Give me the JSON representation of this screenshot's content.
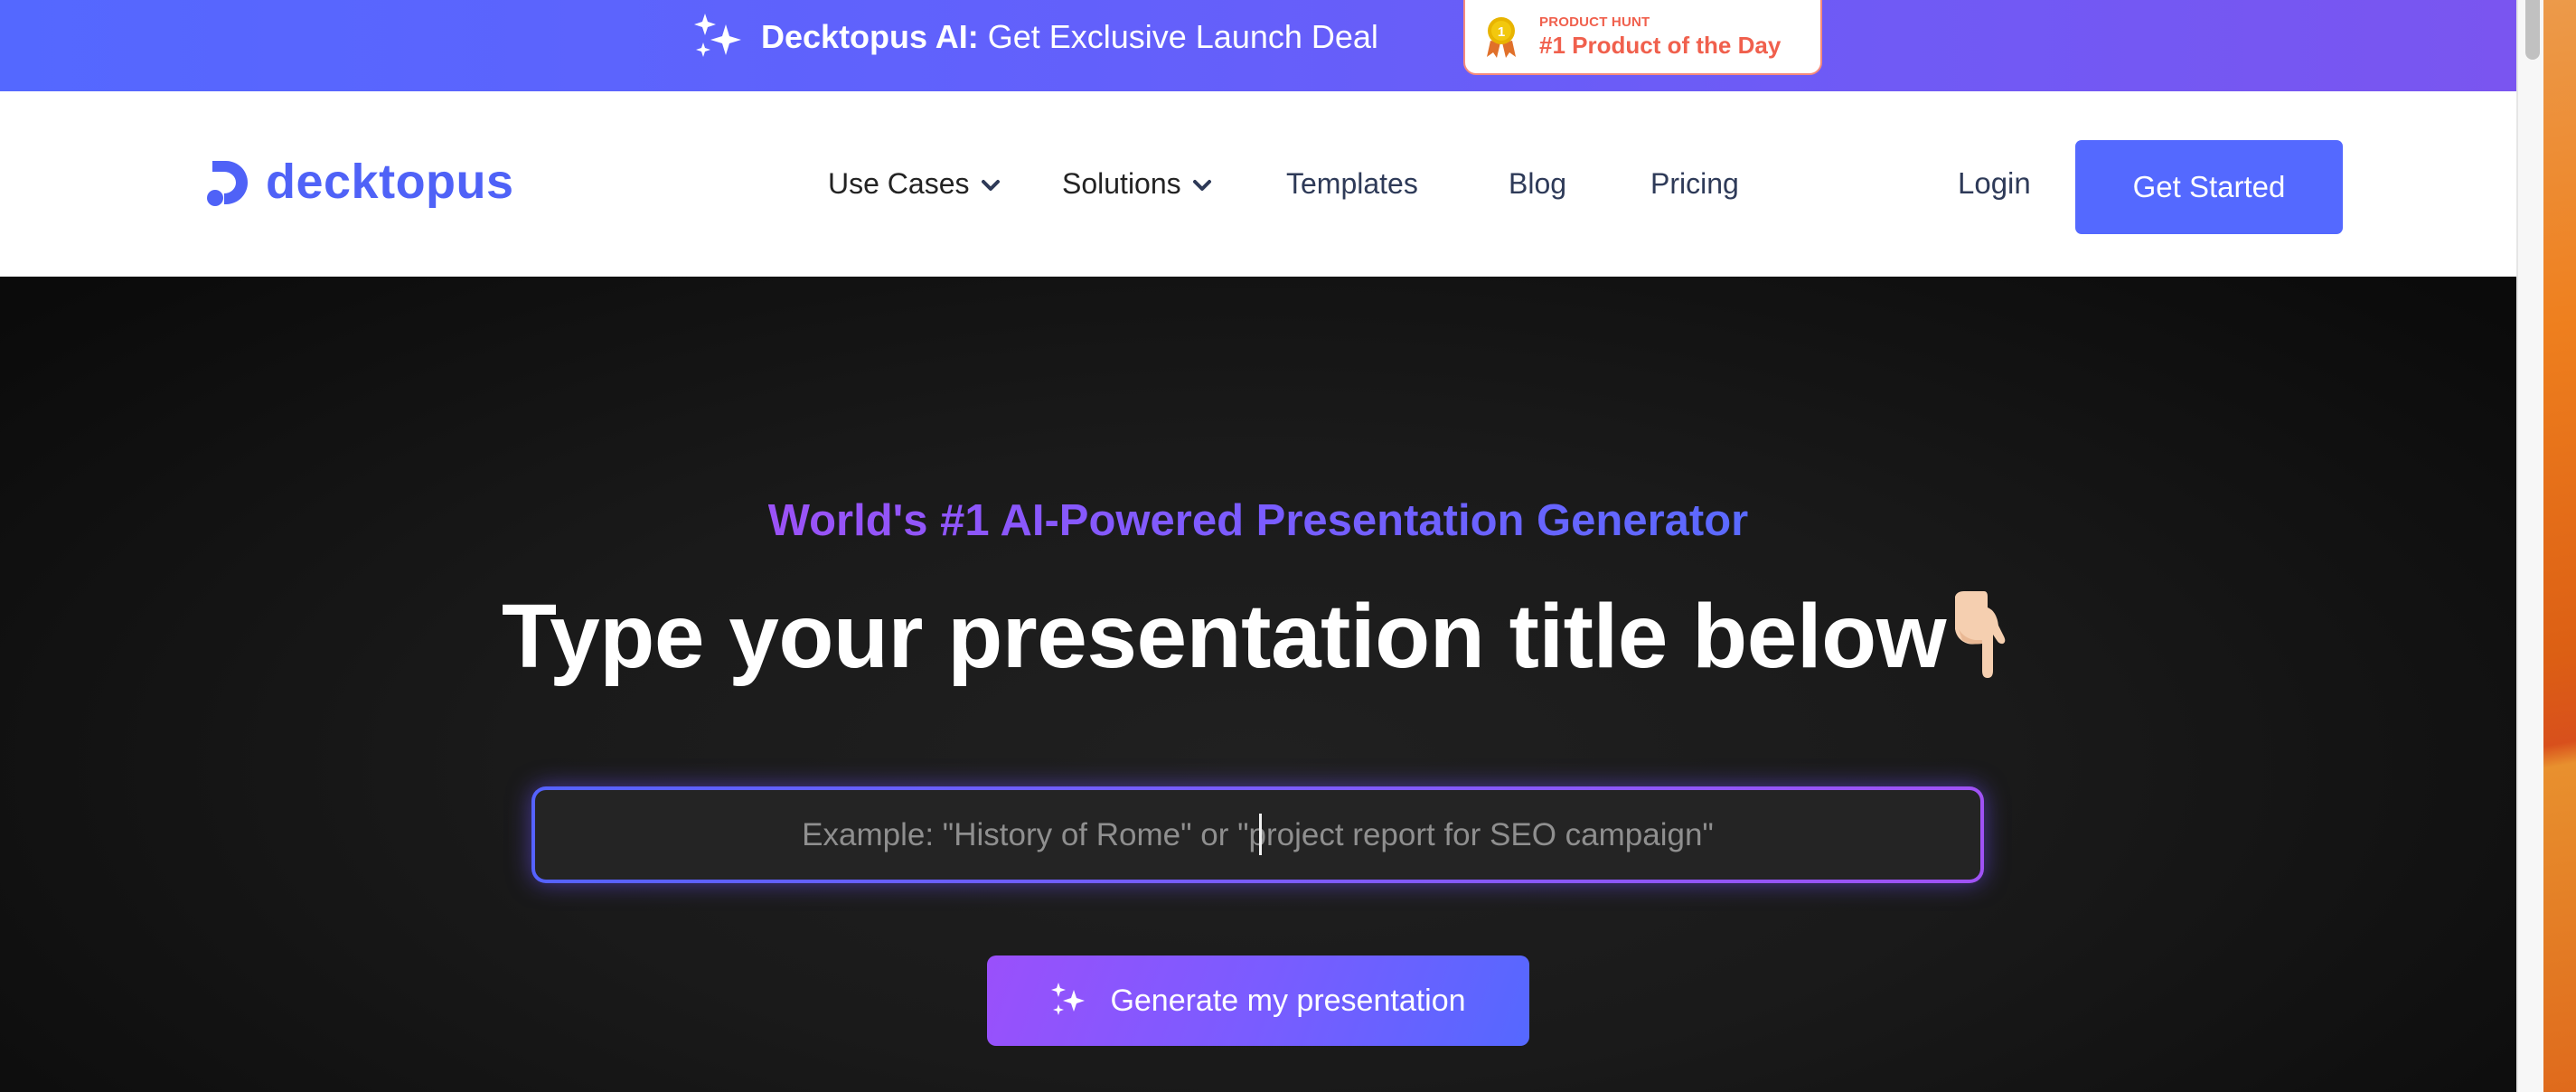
{
  "banner": {
    "icon": "sparkles-icon",
    "title_bold": "Decktopus AI:",
    "title_rest": " Get Exclusive Launch Deal",
    "product_hunt": {
      "icon": "medal-icon",
      "medal_number": "1",
      "label_small": "PRODUCT HUNT",
      "label_big": "#1 Product of the Day"
    }
  },
  "nav": {
    "logo_text": "decktopus",
    "items": [
      {
        "label": "Use Cases",
        "has_dropdown": true
      },
      {
        "label": "Solutions",
        "has_dropdown": true
      },
      {
        "label": "Templates",
        "has_dropdown": false
      },
      {
        "label": "Blog",
        "has_dropdown": false
      },
      {
        "label": "Pricing",
        "has_dropdown": false
      }
    ],
    "login_label": "Login",
    "cta_label": "Get Started"
  },
  "hero": {
    "eyebrow": "World's #1 AI-Powered Presentation Generator",
    "headline": "Type your presentation title below",
    "headline_emoji": "pointing-down-hand-icon",
    "input": {
      "value": "",
      "placeholder": "Example: \"History of Rome\" or \"project report for SEO campaign\""
    },
    "generate_label": "Generate my presentation"
  },
  "colors": {
    "brand": "#5469ff",
    "accent_purple": "#9a50fb",
    "product_hunt": "#f0604d",
    "nav_text": "#2e3a58",
    "hero_bg": "#1a1a1a"
  }
}
